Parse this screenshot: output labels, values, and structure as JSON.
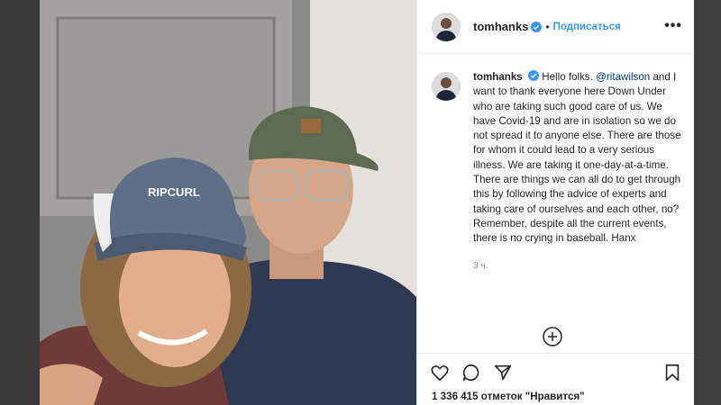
{
  "post": {
    "username": "tomhanks",
    "follow_label": "Подписаться",
    "more_label": "•••",
    "separator": "•"
  },
  "photo": {
    "cap_text": "RIPCURL"
  },
  "caption": {
    "username": "tomhanks",
    "text_before_mention": "Hello folks. ",
    "mention": "@ritawilson",
    "text_after_mention": " and I want to thank everyone here Down Under who are taking such good care of us. We have Covid-19 and are in isolation so we do not spread it to anyone else. There are those for whom it could lead to a very serious illness. We are taking it one-day-at-a-time. There are things we can all do to get through this by following the advice of experts and taking care of ourselves and each other, no? Remember, despite all the current events, there is no crying in baseball. Hanx",
    "time": "3 ч."
  },
  "footer": {
    "likes_text": "1 336 415 отметок \"Нравится\""
  },
  "icons": {
    "heart": "heart-icon",
    "comment": "comment-icon",
    "share": "share-icon",
    "save": "bookmark-icon",
    "add": "plus-circle-icon",
    "verified": "verified-badge-icon"
  },
  "colors": {
    "accent": "#3897f0",
    "mention": "#003569",
    "muted": "#8e8e8e"
  }
}
